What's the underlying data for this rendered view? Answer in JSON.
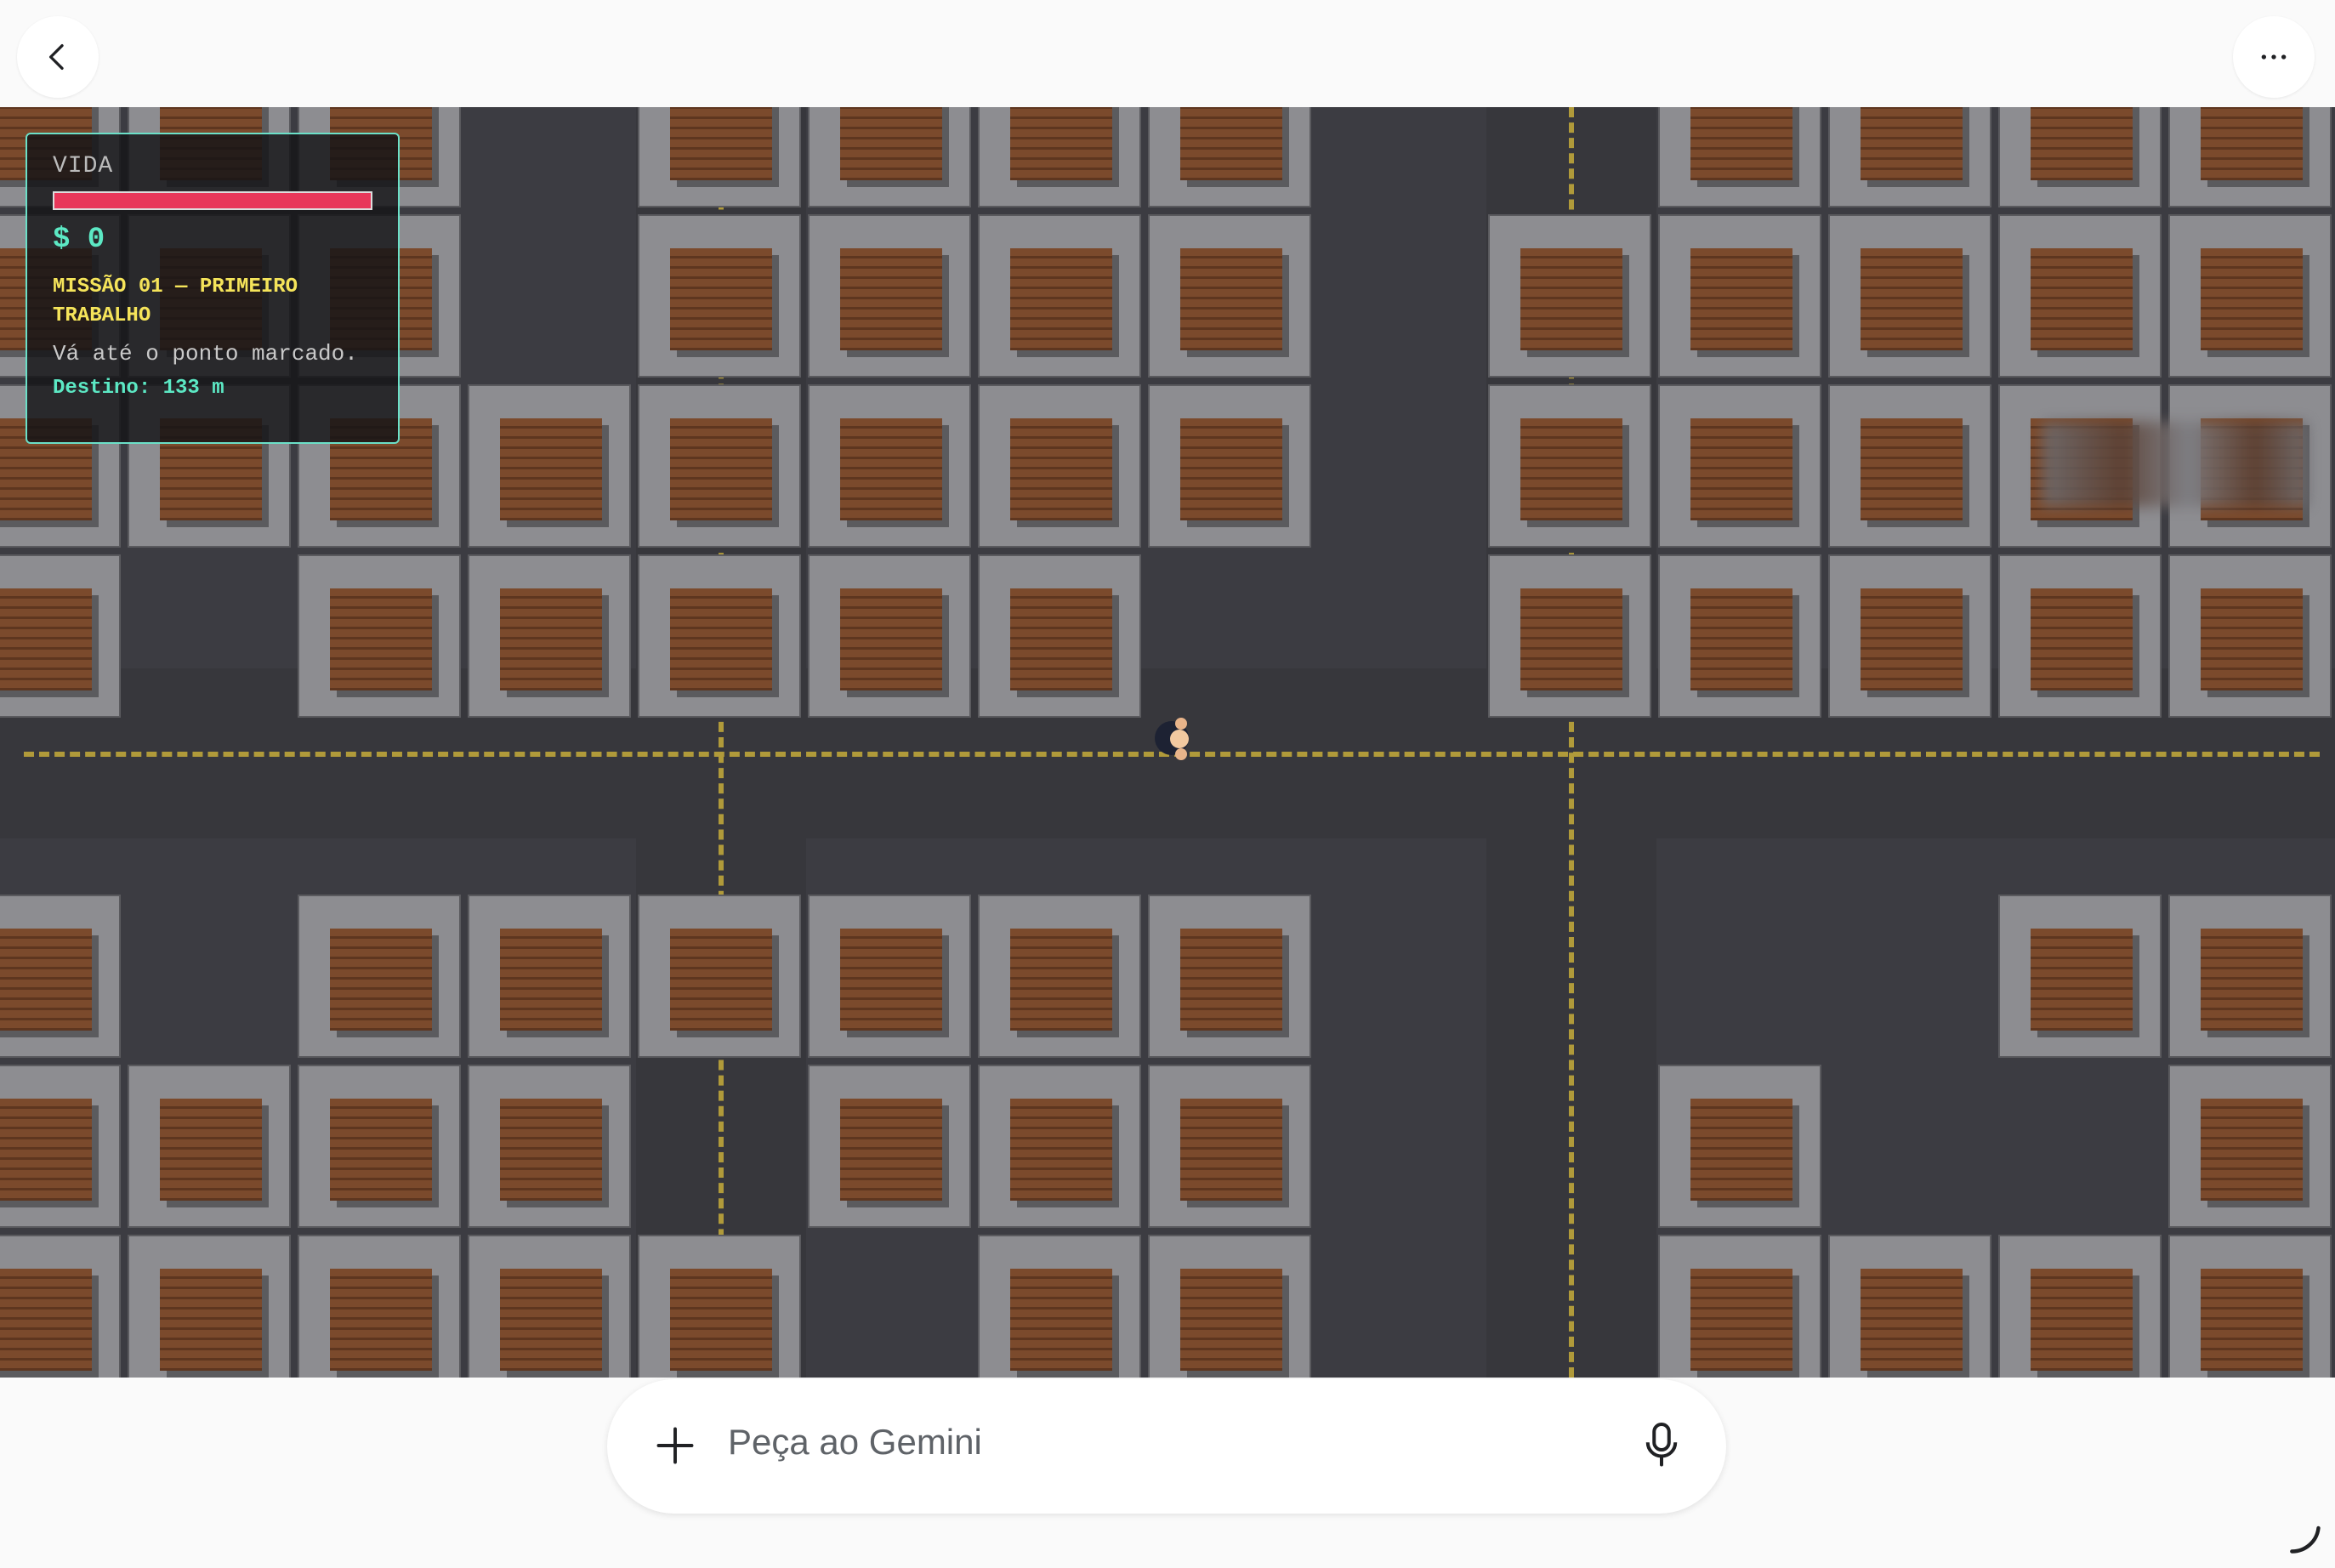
{
  "hud": {
    "life_label": "VIDA",
    "life_fraction": 1.0,
    "money": "$ 0",
    "mission_title": "MISSÃO 01 — PRIMEIRO TRABALHO",
    "mission_desc": "Vá até o ponto marcado.",
    "destination": "Destino: 133 m"
  },
  "prompt": {
    "placeholder": "Peça ao Gemini"
  },
  "colors": {
    "life_bar": "#e8375a",
    "hud_border": "#6be0c8",
    "money_text": "#5ce8c4",
    "mission_text": "#f5e45a"
  },
  "icons": {
    "top_left": "back-chevron-icon",
    "top_right": "more-horizontal-icon",
    "prompt_left": "plus-icon",
    "prompt_right": "microphone-icon",
    "corner": "loading-spinner-icon"
  }
}
